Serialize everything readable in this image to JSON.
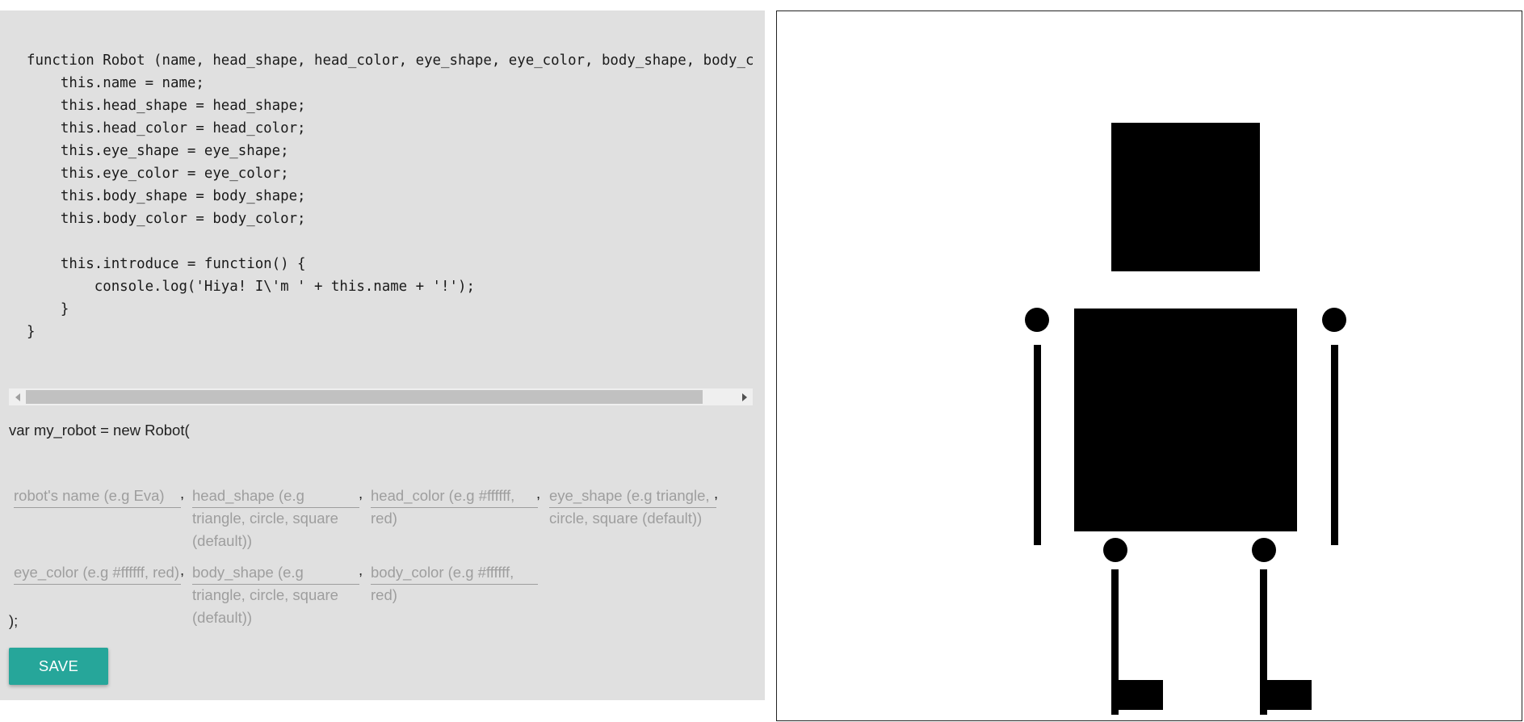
{
  "editor": {
    "code_lines": [
      "function Robot (name, head_shape, head_color, eye_shape, eye_color, body_shape, body_co",
      "    this.name = name;",
      "    this.head_shape = head_shape;",
      "    this.head_color = head_color;",
      "    this.eye_shape = eye_shape;",
      "    this.eye_color = eye_color;",
      "    this.body_shape = body_shape;",
      "    this.body_color = body_color;",
      "",
      "    this.introduce = function() {",
      "        console.log('Hiya! I\\'m ' + this.name + '!');",
      "    }",
      "}"
    ]
  },
  "form": {
    "prefix": "var my_robot = new Robot(",
    "suffix": ");",
    "separator": ",",
    "fields": [
      {
        "id": "name",
        "placeholder": "robot's name (e.g Eva)"
      },
      {
        "id": "head_shape",
        "placeholder": "head_shape (e.g triangle, circle, square (default))"
      },
      {
        "id": "head_color",
        "placeholder": "head_color (e.g #ffffff, red)"
      },
      {
        "id": "eye_shape",
        "placeholder": "eye_shape (e.g triangle, circle, square (default))"
      },
      {
        "id": "eye_color",
        "placeholder": "eye_color (e.g #ffffff, red)"
      },
      {
        "id": "body_shape",
        "placeholder": "body_shape (e.g triangle, circle, square (default))"
      },
      {
        "id": "body_color",
        "placeholder": "body_color (e.g #ffffff, red)"
      }
    ],
    "save_label": "SAVE"
  },
  "robot": {
    "head_shape": "square",
    "body_shape": "square",
    "fill_color": "#000000"
  },
  "colors": {
    "panel_bg": "#e0e0e0",
    "accent": "#26a69a",
    "placeholder": "#9e9e9e"
  }
}
